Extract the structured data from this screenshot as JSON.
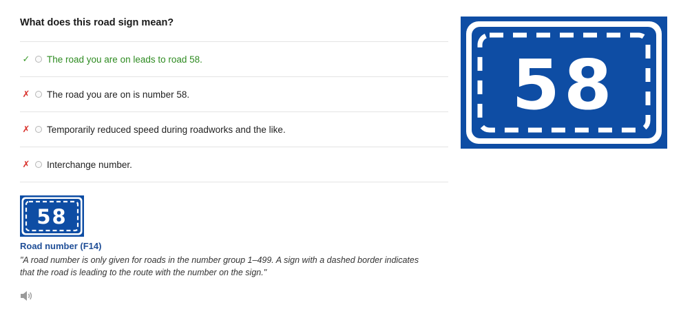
{
  "question": "What does this road sign mean?",
  "options": [
    {
      "text": "The road you are on leads to road 58.",
      "mark": "✓",
      "status": "correct"
    },
    {
      "text": "The road you are on is number 58.",
      "mark": "✗",
      "status": "wrong"
    },
    {
      "text": "Temporarily reduced speed during roadworks and the like.",
      "mark": "✗",
      "status": "wrong"
    },
    {
      "text": "Interchange number.",
      "mark": "✗",
      "status": "wrong"
    }
  ],
  "sign": {
    "number": "58",
    "color": "#0e4da4",
    "title": "Road number (F14)",
    "description": "\"A road number is only given for roads in the number group 1–499. A sign with a dashed border indicates that the road is leading to the route with the number on the sign.\""
  },
  "colors": {
    "correct": "#2e8b21",
    "wrong": "#d9312b",
    "sign_title": "#1f4e97"
  },
  "icons": {
    "audio": "speaker-icon"
  }
}
